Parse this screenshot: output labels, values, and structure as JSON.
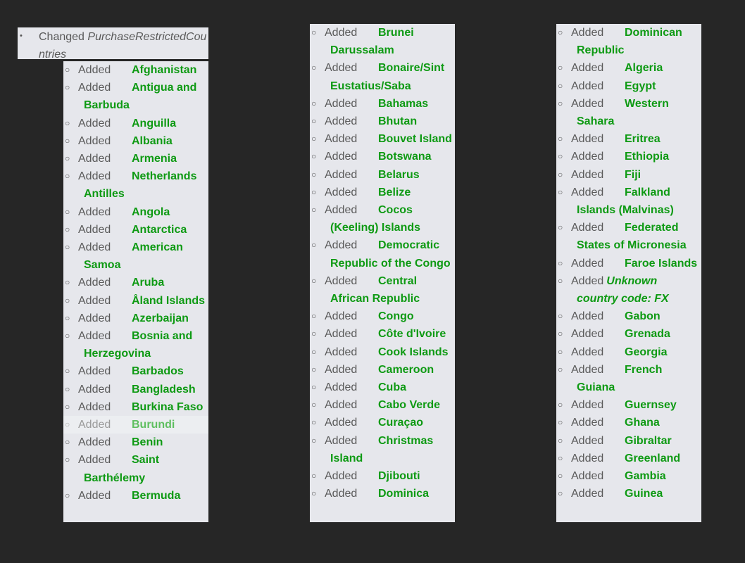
{
  "header": {
    "bullet": "•",
    "prefix": "Changed",
    "field": "PurchaseRestrictedCountries"
  },
  "bullet_char": "○",
  "columns": [
    {
      "items": [
        {
          "verb": "Added",
          "country": "Afghanistan"
        },
        {
          "verb": "Added",
          "country": "Antigua and Barbuda"
        },
        {
          "verb": "Added",
          "country": "Anguilla"
        },
        {
          "verb": "Added",
          "country": "Albania"
        },
        {
          "verb": "Added",
          "country": "Armenia"
        },
        {
          "verb": "Added",
          "country": "Netherlands Antilles"
        },
        {
          "verb": "Added",
          "country": "Angola"
        },
        {
          "verb": "Added",
          "country": "Antarctica"
        },
        {
          "verb": "Added",
          "country": "American Samoa"
        },
        {
          "verb": "Added",
          "country": "Aruba"
        },
        {
          "verb": "Added",
          "country": "Åland Islands"
        },
        {
          "verb": "Added",
          "country": "Azerbaijan"
        },
        {
          "verb": "Added",
          "country": "Bosnia and Herzegovina"
        },
        {
          "verb": "Added",
          "country": "Barbados"
        },
        {
          "verb": "Added",
          "country": "Bangladesh"
        },
        {
          "verb": "Added",
          "country": "Burkina Faso"
        },
        {
          "verb": "Added",
          "country": "Burundi",
          "faded": true
        },
        {
          "verb": "Added",
          "country": "Benin"
        },
        {
          "verb": "Added",
          "country": "Saint Barthélemy"
        },
        {
          "verb": "Added",
          "country": "Bermuda"
        }
      ]
    },
    {
      "items": [
        {
          "verb": "Added",
          "country": "Brunei Darussalam"
        },
        {
          "verb": "Added",
          "country": "Bonaire/Sint Eustatius/Saba"
        },
        {
          "verb": "Added",
          "country": "Bahamas"
        },
        {
          "verb": "Added",
          "country": "Bhutan"
        },
        {
          "verb": "Added",
          "country": "Bouvet Island"
        },
        {
          "verb": "Added",
          "country": "Botswana"
        },
        {
          "verb": "Added",
          "country": "Belarus"
        },
        {
          "verb": "Added",
          "country": "Belize"
        },
        {
          "verb": "Added",
          "country": "Cocos (Keeling) Islands"
        },
        {
          "verb": "Added",
          "country": "Democratic Republic of the Congo"
        },
        {
          "verb": "Added",
          "country": "Central African Republic"
        },
        {
          "verb": "Added",
          "country": "Congo"
        },
        {
          "verb": "Added",
          "country": "Côte d'Ivoire"
        },
        {
          "verb": "Added",
          "country": "Cook Islands"
        },
        {
          "verb": "Added",
          "country": "Cameroon"
        },
        {
          "verb": "Added",
          "country": "Cuba"
        },
        {
          "verb": "Added",
          "country": "Cabo Verde"
        },
        {
          "verb": "Added",
          "country": "Curaçao"
        },
        {
          "verb": "Added",
          "country": "Christmas Island"
        },
        {
          "verb": "Added",
          "country": "Djibouti"
        },
        {
          "verb": "Added",
          "country": "Dominica"
        }
      ]
    },
    {
      "items": [
        {
          "verb": "Added",
          "country": "Dominican Republic"
        },
        {
          "verb": "Added",
          "country": "Algeria"
        },
        {
          "verb": "Added",
          "country": "Egypt"
        },
        {
          "verb": "Added",
          "country": "Western Sahara"
        },
        {
          "verb": "Added",
          "country": "Eritrea"
        },
        {
          "verb": "Added",
          "country": "Ethiopia"
        },
        {
          "verb": "Added",
          "country": "Fiji"
        },
        {
          "verb": "Added",
          "country": "Falkland Islands (Malvinas)"
        },
        {
          "verb": "Added",
          "country": "Federated States of Micronesia"
        },
        {
          "verb": "Added",
          "country": "Faroe Islands"
        },
        {
          "verb": "Added",
          "country": "Unknown country code: FX",
          "italic": true
        },
        {
          "verb": "Added",
          "country": "Gabon"
        },
        {
          "verb": "Added",
          "country": "Grenada"
        },
        {
          "verb": "Added",
          "country": "Georgia"
        },
        {
          "verb": "Added",
          "country": "French Guiana"
        },
        {
          "verb": "Added",
          "country": "Guernsey"
        },
        {
          "verb": "Added",
          "country": "Ghana"
        },
        {
          "verb": "Added",
          "country": "Gibraltar"
        },
        {
          "verb": "Added",
          "country": "Greenland"
        },
        {
          "verb": "Added",
          "country": "Gambia"
        },
        {
          "verb": "Added",
          "country": "Guinea"
        }
      ]
    }
  ],
  "colors": {
    "background": "#262626",
    "panel": "#e6e7ec",
    "country": "#0e9a13",
    "verb": "#5a5a5a"
  }
}
